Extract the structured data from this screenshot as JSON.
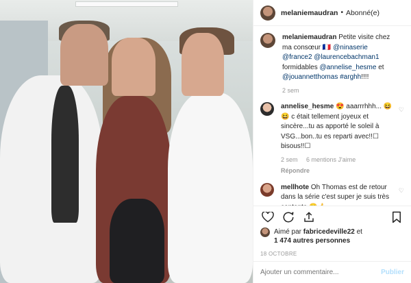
{
  "header": {
    "username": "melaniemaudran",
    "separator": "•",
    "follow_label": "Abonné(e)"
  },
  "caption": {
    "username": "melaniemaudran",
    "text_before": "Petite visite chez ma consœur 🇫🇷 ",
    "tag1": "@ninaserie",
    "tag2": "@france2",
    "tag3": "@laurencebachman1",
    "mid": " formidables ",
    "tag4": "@annelise_hesme",
    "and": " et ",
    "tag5": "@jouannetthomas",
    "tag6": "#arghh",
    "end": "!!!!",
    "time": "2 sem"
  },
  "comments": [
    {
      "username": "annelise_hesme",
      "text": " 😍 aaarrrhhh... 😆😆 c était tellement joyeux et sincère...tu as apporté le soleil à VSG...bon..tu es reparti avec!!☐ bisous!!☐",
      "time": "2 sem",
      "likes": "6 mentions J'aime",
      "reply": "Répondre"
    },
    {
      "username": "mellhote",
      "text": " Oh Thomas est de retour dans la série c'est super je suis très contente 😀👍",
      "time": "",
      "likes": "",
      "reply": ""
    }
  ],
  "likes": {
    "prefix": "Aimé par ",
    "user": "fabricedeville22",
    "mid": " et",
    "count": "1 474 autres personnes"
  },
  "date": "18 OCTOBRE",
  "add_comment": {
    "placeholder": "Ajouter un commentaire...",
    "publish": "Publier"
  },
  "icons": [
    "heart-icon",
    "comment-icon",
    "share-icon",
    "bookmark-icon"
  ]
}
